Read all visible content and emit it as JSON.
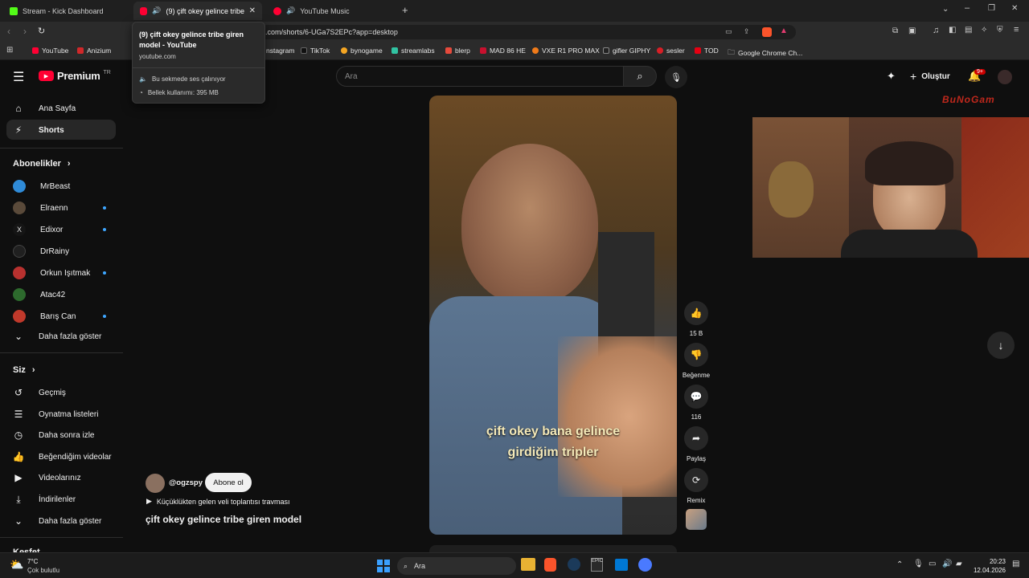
{
  "tabs": [
    {
      "title": "Stream - Kick Dashboard"
    },
    {
      "title": "(9) çift okey gelince tribe giren"
    },
    {
      "title": "YouTube Music"
    }
  ],
  "address": {
    "url": ".com/shorts/6-UGa7S2EPc?app=desktop"
  },
  "bookmarks": [
    "YouTube",
    "Anizium",
    "nstagram",
    "TikTok",
    "bynogame",
    "streamlabs",
    "blerp",
    "MAD 86 HE",
    "VXE R1 PRO MAX",
    "gifler GIPHY",
    "sesler",
    "TOD",
    "Google Chrome Ch..."
  ],
  "tooltip": {
    "title": "(9) çift okey gelince tribe giren model - YouTube",
    "domain": "youtube.com",
    "audio": "Bu sekmede ses çalınıyor",
    "memory": "Bellek kullanımı: 395 MB"
  },
  "yt": {
    "logo": "Premium",
    "region": "TR",
    "search_placeholder": "Ara",
    "create_label": "Oluştur",
    "notif_count": "9+"
  },
  "sidebar": {
    "home": "Ana Sayfa",
    "shorts": "Shorts",
    "subs_header": "Abonelikler",
    "subs": [
      "MrBeast",
      "Elraenn",
      "Edixor",
      "DrRainy",
      "Orkun Işıtmak",
      "Atac42",
      "Barış Can"
    ],
    "show_more": "Daha fazla göster",
    "you_header": "Siz",
    "you_items": [
      "Geçmiş",
      "Oynatma listeleri",
      "Daha sonra izle",
      "Beğendiğim videolar",
      "Videolarınız",
      "İndirilenler",
      "Daha fazla göster"
    ],
    "next_header": "Keşfet"
  },
  "video": {
    "caption_line1": "çift okey bana gelince",
    "caption_line2": "girdiğim tripler",
    "channel": "@ogzspy",
    "subscribe": "Abone ol",
    "playlist": "Küçüklükten gelen veli toplantısı travması",
    "title": "çift okey gelince tribe giren model"
  },
  "actions": {
    "likes": "15 B",
    "dislike": "Beğenme",
    "comments": "116",
    "share": "Paylaş",
    "remix": "Remix"
  },
  "overlay": {
    "brand": "BuNoGam"
  },
  "taskbar": {
    "temp": "7°C",
    "weather": "Çok bulutlu",
    "search": "Ara",
    "time": "20:23",
    "date": "12.04.2026"
  }
}
